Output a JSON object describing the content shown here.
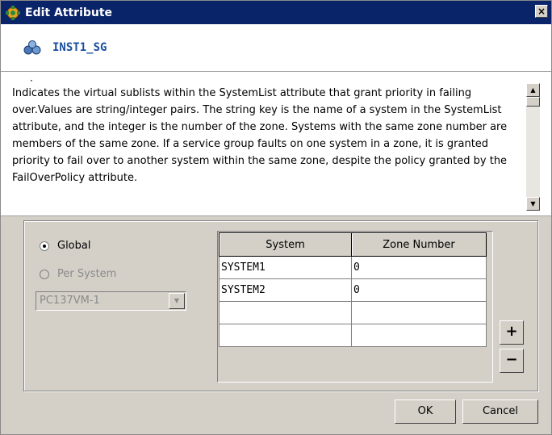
{
  "window": {
    "title": "Edit Attribute",
    "close_label": "×"
  },
  "header": {
    "title": "INST1_SG"
  },
  "description": {
    "marker": "·",
    "text": "Indicates the virtual sublists within the SystemList attribute that grant priority in failing over.Values are string/integer pairs. The string key is the name of a system in the SystemList attribute, and the integer is the number of the zone. Systems with the same zone number are members of the same zone. If a service group faults on one system in a zone, it is granted priority to fail over to another system within the same zone, despite the policy granted by the FailOverPolicy attribute."
  },
  "scope": {
    "global_label": "Global",
    "per_system_label": "Per System",
    "selected": "Global",
    "system_select_value": "PC137VM-1"
  },
  "table": {
    "columns": [
      "System",
      "Zone Number"
    ],
    "rows": [
      [
        "SYSTEM1",
        "0"
      ],
      [
        "SYSTEM2",
        "0"
      ],
      [
        "",
        ""
      ],
      [
        "",
        ""
      ]
    ]
  },
  "buttons": {
    "add": "+",
    "remove": "−",
    "ok": "OK",
    "cancel": "Cancel"
  },
  "colors": {
    "titlebar": "#0a246a",
    "header_text": "#1a4fa0",
    "face": "#d4d0c8"
  }
}
